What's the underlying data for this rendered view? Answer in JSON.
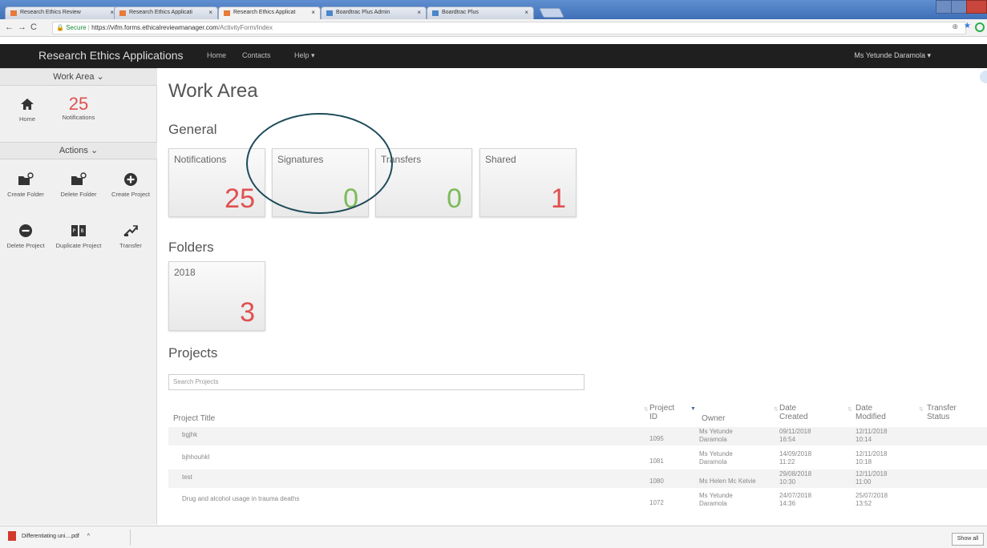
{
  "browser": {
    "tabs": [
      {
        "label": "Research Ethics Review",
        "active": false
      },
      {
        "label": "Research Ethics Applicati",
        "active": false
      },
      {
        "label": "Research Ethics Applicat",
        "active": true
      },
      {
        "label": "Boardtrac Plus Admin",
        "active": false
      },
      {
        "label": "Boardtrac Plus",
        "active": false
      }
    ],
    "url_secure_label": "Secure",
    "url_host": "https://vifm.forms.ethicalreviewmanager.com",
    "url_path": "/ActivityForm/Index"
  },
  "navbar": {
    "brand": "Research Ethics Applications",
    "links": [
      "Home",
      "Contacts",
      "Help ▾"
    ],
    "user": "Ms Yetunde Daramola ▾"
  },
  "sidebar": {
    "work_area_header": "Work Area ⌄",
    "notifications_count": "25",
    "home_label": "Home",
    "notifications_label": "Notifications",
    "actions_header": "Actions ⌄",
    "actions": [
      {
        "label": "Create Folder",
        "icon": "folder-add-icon"
      },
      {
        "label": "Delete Folder",
        "icon": "folder-delete-icon"
      },
      {
        "label": "Create Project",
        "icon": "plus-circle-icon"
      },
      {
        "label": "Delete Project",
        "icon": "minus-circle-icon"
      },
      {
        "label": "Duplicate Project",
        "icon": "duplicate-icon"
      },
      {
        "label": "Transfer",
        "icon": "transfer-icon"
      }
    ]
  },
  "main": {
    "title": "Work Area",
    "general_heading": "General",
    "general_tiles": [
      {
        "label": "Notifications",
        "value": "25",
        "color": "#e05050"
      },
      {
        "label": "Signatures",
        "value": "0",
        "color": "#7cbb5a"
      },
      {
        "label": "Transfers",
        "value": "0",
        "color": "#7cbb5a"
      },
      {
        "label": "Shared",
        "value": "1",
        "color": "#e05050"
      }
    ],
    "folders_heading": "Folders",
    "folders": [
      {
        "label": "2018",
        "value": "3"
      }
    ],
    "projects_heading": "Projects",
    "search_placeholder": "Search Projects",
    "columns": {
      "title": "Project Title",
      "id_line1": "Project",
      "id_line2": "ID",
      "owner": "Owner",
      "created_line1": "Date",
      "created_line2": "Created",
      "modified_line1": "Date",
      "modified_line2": "Modified",
      "transfer_line1": "Transfer",
      "transfer_line2": "Status"
    },
    "rows": [
      {
        "title": "bgjhk",
        "id": "1095",
        "owner1": "Ms Yetunde",
        "owner2": "Daramola",
        "created1": "09/11/2018",
        "created2": "16:54",
        "modified1": "12/11/2018",
        "modified2": "10:14"
      },
      {
        "title": "bjhhouhkl",
        "id": "1081",
        "owner1": "Ms Yetunde",
        "owner2": "Daramola",
        "created1": "14/09/2018",
        "created2": "11:22",
        "modified1": "12/11/2018",
        "modified2": "10:18"
      },
      {
        "title": "test",
        "id": "1080",
        "owner1": "Ms Helen Mc Kelvie",
        "owner2": "",
        "created1": "29/08/2018",
        "created2": "10:30",
        "modified1": "12/11/2018",
        "modified2": "11:00"
      },
      {
        "title": "Drug and alcohol usage in trauma deaths",
        "id": "1072",
        "owner1": "Ms Yetunde",
        "owner2": "Daramola",
        "created1": "24/07/2018",
        "created2": "14:36",
        "modified1": "25/07/2018",
        "modified2": "13:52"
      }
    ]
  },
  "downloads": {
    "file": "Differentiating uni....pdf",
    "show_all": "Show all"
  }
}
